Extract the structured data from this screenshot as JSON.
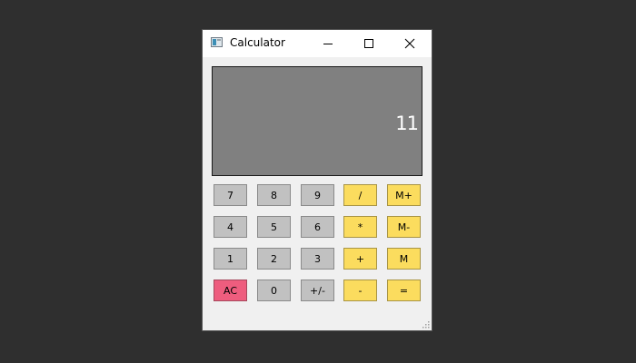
{
  "window": {
    "title": "Calculator"
  },
  "display": {
    "value": "11"
  },
  "keys": {
    "k7": "7",
    "k8": "8",
    "k9": "9",
    "div": "/",
    "mplus": "M+",
    "k4": "4",
    "k5": "5",
    "k6": "6",
    "mul": "*",
    "mminus": "M-",
    "k1": "1",
    "k2": "2",
    "k3": "3",
    "add": "+",
    "mrecall": "M",
    "ac": "AC",
    "k0": "0",
    "sign": "+/-",
    "sub": "-",
    "eq": "="
  },
  "colors": {
    "number_key": "#c1c1c1",
    "operator_key": "#fbdc5e",
    "clear_key": "#ee5d7e",
    "display_bg": "#808080"
  },
  "icons": {
    "app": "calculator-app-icon",
    "minimize": "minimize-icon",
    "maximize": "maximize-icon",
    "close": "close-icon",
    "resize": "resize-grip-icon"
  }
}
